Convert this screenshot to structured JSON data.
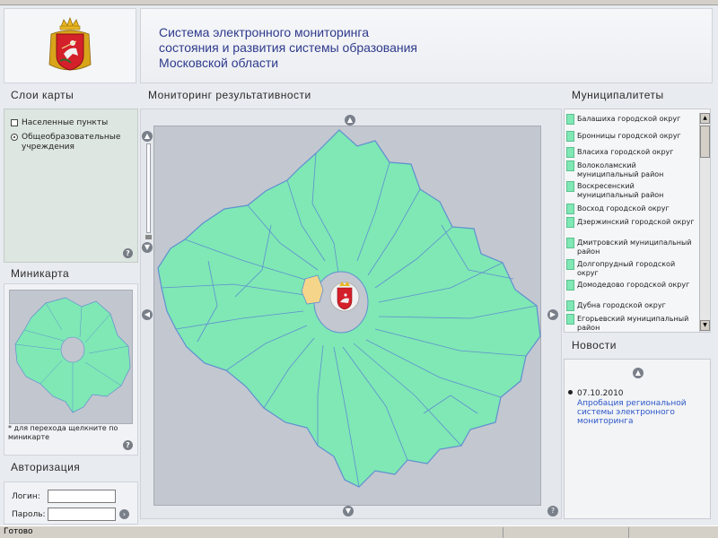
{
  "header": {
    "title_lines": [
      "Система электронного мониторинга",
      "состояния и развития системы образования",
      "Московской области"
    ]
  },
  "layers": {
    "title": "Слои карты",
    "items": [
      {
        "label": "Населенные пункты",
        "checked": false
      },
      {
        "label": "Общеобразовательные учреждения",
        "selected": true
      }
    ],
    "help": "?"
  },
  "minimap": {
    "title": "Миникарта",
    "note": "* для перехода щелкните по миникарте",
    "help": "?"
  },
  "auth": {
    "title": "Авторизация",
    "login_label": "Логин:",
    "password_label": "Пароль:",
    "login_value": "",
    "password_value": "",
    "submit_icon": "arrow-right-icon"
  },
  "map": {
    "title": "Мониторинг результативности",
    "region_color": "#7fe8b5",
    "highlight_color": "#f5d58a",
    "border_color": "#5f8fd0",
    "icons": [
      "arrow-up-icon",
      "arrow-down-icon",
      "arrow-left-icon",
      "arrow-right-icon",
      "zoom-in-icon",
      "zoom-out-icon",
      "coat-of-arms-icon"
    ]
  },
  "municipalities": {
    "title": "Муниципалитеты",
    "items": [
      "Балашиха городской округ",
      "Бронницы городской округ",
      "Власиха городской округ",
      "Волоколамский муниципальный район",
      "Воскресенский муниципальный район",
      "Восход городской округ",
      "Дзержинский городской округ",
      "Дмитровский муниципальный район",
      "Долгопрудный городской округ",
      "Домодедово городской округ",
      "Дубна городской округ",
      "Егорьевский муниципальный район"
    ]
  },
  "news": {
    "title": "Новости",
    "items": [
      {
        "date": "07.10.2010",
        "text": "Апробация региональной системы электронного мониторинга"
      }
    ]
  },
  "status": {
    "text": "Готово"
  }
}
